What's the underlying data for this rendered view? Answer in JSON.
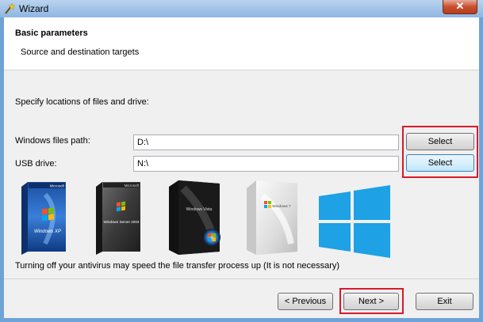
{
  "window": {
    "title": "Wizard",
    "close_glyph": "✕"
  },
  "header": {
    "title": "Basic parameters",
    "subtitle": "Source and destination targets"
  },
  "instruction": "Specify locations of files and drive:",
  "windows_path": {
    "label": "Windows files path:",
    "value": "D:\\",
    "button": "Select"
  },
  "usb_drive": {
    "label": "USB drive:",
    "value": "N:\\",
    "button": "Select"
  },
  "logos": {
    "xp": {
      "brand": "Microsoft",
      "product": "Windows XP"
    },
    "server": {
      "brand": "Microsoft",
      "product": "Windows Server 2003"
    },
    "vista": {
      "product": "Windows Vista"
    },
    "seven": {
      "product": "Windows 7"
    }
  },
  "notice": "Turning off your antivirus may speed the file transfer process up (It is not necessary)",
  "footer": {
    "prev": "< Previous",
    "next": "Next >",
    "exit": "Exit"
  },
  "colors": {
    "highlight": "#d91a2a",
    "frame": "#6fa3d6",
    "win8": "#1ea1e5"
  }
}
